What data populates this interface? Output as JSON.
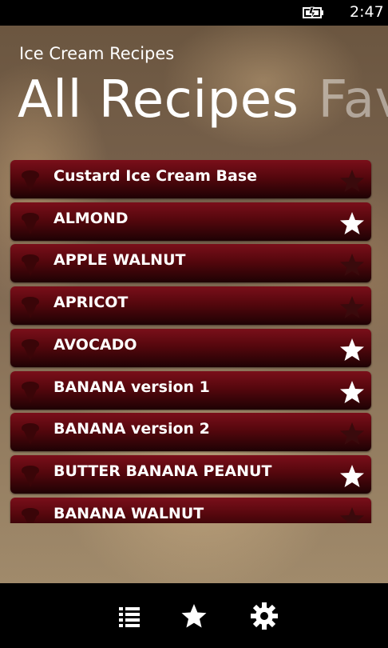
{
  "status": {
    "time": "2:47"
  },
  "app": {
    "title": "Ice Cream Recipes"
  },
  "pivot": {
    "tabs": [
      "All Recipes",
      "Favorites"
    ]
  },
  "recipes": [
    {
      "name": "Custard Ice Cream Base",
      "favorite": false
    },
    {
      "name": "ALMOND",
      "favorite": true
    },
    {
      "name": "APPLE WALNUT",
      "favorite": false
    },
    {
      "name": "APRICOT",
      "favorite": false
    },
    {
      "name": "AVOCADO",
      "favorite": true
    },
    {
      "name": "BANANA version 1",
      "favorite": true
    },
    {
      "name": "BANANA version 2",
      "favorite": false
    },
    {
      "name": "BUTTER BANANA PEANUT",
      "favorite": true
    },
    {
      "name": "BANANA WALNUT",
      "favorite": false
    }
  ],
  "appbar": {
    "buttons": [
      {
        "icon": "list-icon"
      },
      {
        "icon": "star-icon"
      },
      {
        "icon": "settings-icon"
      }
    ]
  },
  "colors": {
    "row_top": "#7a0f1a",
    "row_bottom": "#1e0204",
    "star_on": "#ffffff",
    "star_off": "#3a0a0c"
  }
}
